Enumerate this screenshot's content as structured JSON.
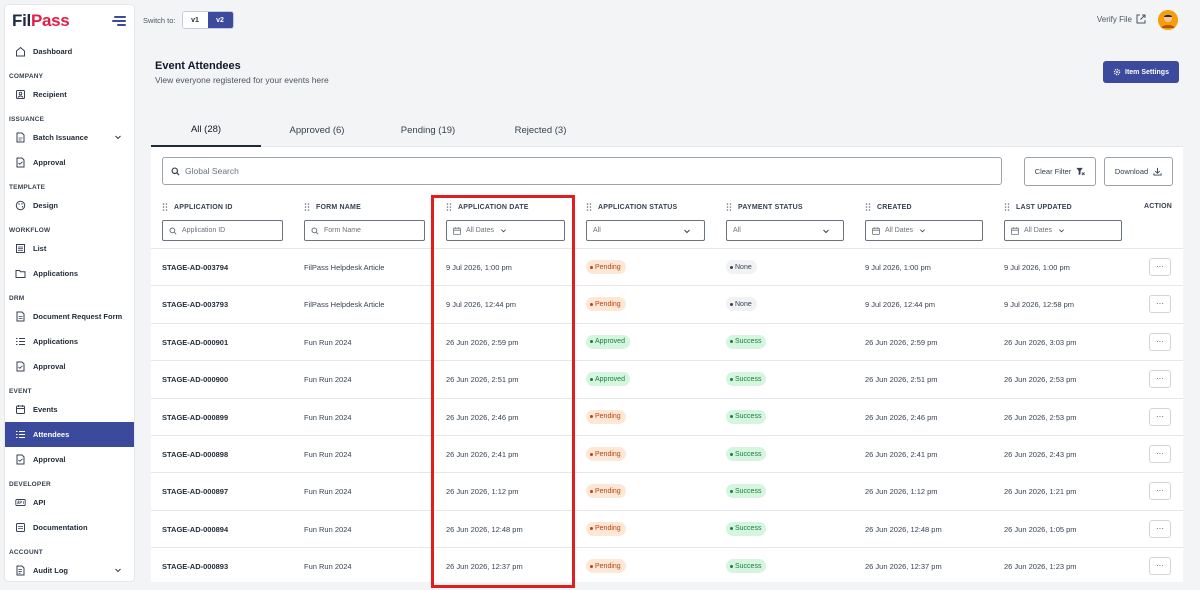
{
  "brand": {
    "name_a": "Fil",
    "name_b": "Pass"
  },
  "topbar": {
    "switch_label": "Switch to:",
    "v1": "v1",
    "v2": "v2",
    "verify": "Verify File"
  },
  "sidebar": [
    {
      "type": "item",
      "label": "Dashboard",
      "icon": "home-icon"
    },
    {
      "type": "section",
      "label": "COMPANY"
    },
    {
      "type": "item",
      "label": "Recipient",
      "icon": "contact-icon"
    },
    {
      "type": "section",
      "label": "ISSUANCE"
    },
    {
      "type": "item",
      "label": "Batch Issuance",
      "icon": "file-stack-icon",
      "chevron": true
    },
    {
      "type": "item",
      "label": "Approval",
      "icon": "file-check-icon"
    },
    {
      "type": "section",
      "label": "TEMPLATE"
    },
    {
      "type": "item",
      "label": "Design",
      "icon": "palette-icon"
    },
    {
      "type": "section",
      "label": "WORKFLOW"
    },
    {
      "type": "item",
      "label": "List",
      "icon": "list-icon"
    },
    {
      "type": "item",
      "label": "Applications",
      "icon": "folder-icon"
    },
    {
      "type": "section",
      "label": "DRM"
    },
    {
      "type": "item",
      "label": "Document Request Form",
      "icon": "file-icon"
    },
    {
      "type": "item",
      "label": "Applications",
      "icon": "list-ordered-icon"
    },
    {
      "type": "item",
      "label": "Approval",
      "icon": "file-check-icon"
    },
    {
      "type": "section",
      "label": "EVENT"
    },
    {
      "type": "item",
      "label": "Events",
      "icon": "calendar-icon"
    },
    {
      "type": "item",
      "label": "Attendees",
      "icon": "list-ordered-icon",
      "active": true
    },
    {
      "type": "item",
      "label": "Approval",
      "icon": "file-check-icon"
    },
    {
      "type": "section",
      "label": "DEVELOPER"
    },
    {
      "type": "item",
      "label": "API",
      "icon": "api-icon"
    },
    {
      "type": "item",
      "label": "Documentation",
      "icon": "doc-icon"
    },
    {
      "type": "section",
      "label": "ACCOUNT"
    },
    {
      "type": "item",
      "label": "Audit Log",
      "icon": "log-icon",
      "chevron": true
    }
  ],
  "header": {
    "title": "Event Attendees",
    "subtitle": "View everyone registered for your events here",
    "settings_label": "Item Settings"
  },
  "tabs": [
    {
      "label": "All (28)",
      "active": true
    },
    {
      "label": "Approved (6)"
    },
    {
      "label": "Pending (19)"
    },
    {
      "label": "Rejected (3)"
    }
  ],
  "toolbar": {
    "search_placeholder": "Global Search",
    "clear_filter": "Clear Filter",
    "download": "Download"
  },
  "columns": {
    "id": "APPLICATION ID",
    "form": "FORM NAME",
    "date": "APPLICATION DATE",
    "status": "APPLICATION STATUS",
    "payment": "PAYMENT STATUS",
    "created": "CREATED",
    "updated": "LAST UPDATED",
    "action": "ACTION"
  },
  "filters": {
    "id": "Application ID",
    "form": "Form Name",
    "date": "All Dates",
    "status": "All",
    "payment": "All",
    "created": "All Dates",
    "updated": "All Dates"
  },
  "rows": [
    {
      "id": "STAGE-AD-003794",
      "form": "FilPass Helpdesk Article",
      "date": "9 Jul 2026, 1:00 pm",
      "status": "Pending",
      "payment": "None",
      "created": "9 Jul 2026, 1:00 pm",
      "updated": "9 Jul 2026, 1:00 pm"
    },
    {
      "id": "STAGE-AD-003793",
      "form": "FilPass Helpdesk Article",
      "date": "9 Jul 2026, 12:44 pm",
      "status": "Pending",
      "payment": "None",
      "created": "9 Jul 2026, 12:44 pm",
      "updated": "9 Jul 2026, 12:58 pm"
    },
    {
      "id": "STAGE-AD-000901",
      "form": "Fun Run 2024",
      "date": "26 Jun 2026, 2:59 pm",
      "status": "Approved",
      "payment": "Success",
      "created": "26 Jun 2026, 2:59 pm",
      "updated": "26 Jun 2026, 3:03 pm"
    },
    {
      "id": "STAGE-AD-000900",
      "form": "Fun Run 2024",
      "date": "26 Jun 2026, 2:51 pm",
      "status": "Approved",
      "payment": "Success",
      "created": "26 Jun 2026, 2:51 pm",
      "updated": "26 Jun 2026, 2:53 pm"
    },
    {
      "id": "STAGE-AD-000899",
      "form": "Fun Run 2024",
      "date": "26 Jun 2026, 2:46 pm",
      "status": "Pending",
      "payment": "Success",
      "created": "26 Jun 2026, 2:46 pm",
      "updated": "26 Jun 2026, 2:53 pm"
    },
    {
      "id": "STAGE-AD-000898",
      "form": "Fun Run 2024",
      "date": "26 Jun 2026, 2:41 pm",
      "status": "Pending",
      "payment": "Success",
      "created": "26 Jun 2026, 2:41 pm",
      "updated": "26 Jun 2026, 2:43 pm"
    },
    {
      "id": "STAGE-AD-000897",
      "form": "Fun Run 2024",
      "date": "26 Jun 2026, 1:12 pm",
      "status": "Pending",
      "payment": "Success",
      "created": "26 Jun 2026, 1:12 pm",
      "updated": "26 Jun 2026, 1:21 pm"
    },
    {
      "id": "STAGE-AD-000894",
      "form": "Fun Run 2024",
      "date": "26 Jun 2026, 12:48 pm",
      "status": "Pending",
      "payment": "Success",
      "created": "26 Jun 2026, 12:48 pm",
      "updated": "26 Jun 2026, 1:05 pm"
    },
    {
      "id": "STAGE-AD-000893",
      "form": "Fun Run 2024",
      "date": "26 Jun 2026, 12:37 pm",
      "status": "Pending",
      "payment": "Success",
      "created": "26 Jun 2026, 12:37 pm",
      "updated": "26 Jun 2026, 1:23 pm"
    }
  ],
  "action_label": "···",
  "colors": {
    "accent": "#3b4a9c",
    "highlight": "#e01e1e",
    "pending": "#c2410c",
    "success": "#15803d"
  }
}
